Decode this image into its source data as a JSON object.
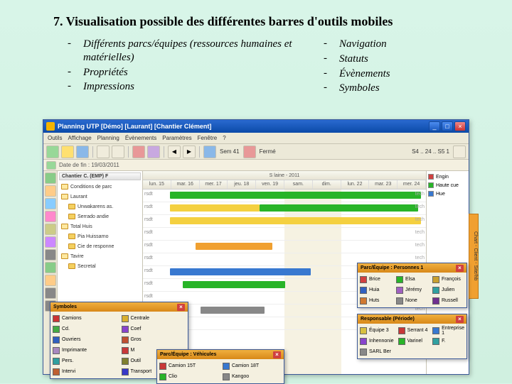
{
  "page": {
    "title": "7. Visualisation possible des différentes barres d'outils mobiles"
  },
  "bullets": {
    "left": [
      "Différents parcs/équipes (ressources humaines et matérielles)",
      "Propriétés",
      "Impressions"
    ],
    "right": [
      "Navigation",
      "Statuts",
      "Évènements",
      "Symboles"
    ]
  },
  "app": {
    "title": "Planning UTP [Démo]  [Laurant]  [Chantier Clément]",
    "winbtns": {
      "min": "_",
      "max": "□",
      "close": "×"
    },
    "menu": [
      "Outils",
      "Affichage",
      "Planning",
      "Évènements",
      "Paramètres",
      "Fenêtre",
      "?"
    ],
    "toolbar": {
      "label_sem": "Sem 41",
      "label_ferme": "Fermé",
      "label_range": "S4 .. 24 .. S5 1"
    },
    "dateline": "Date de fin : 19/03/2011",
    "tree_header": "Chantier C. (EMP) F",
    "tree": [
      {
        "lvl": 0,
        "label": "Conditions de parc"
      },
      {
        "lvl": 0,
        "label": "Laurant"
      },
      {
        "lvl": 1,
        "label": "Unwakarens as."
      },
      {
        "lvl": 1,
        "label": "Serrado andie"
      },
      {
        "lvl": 0,
        "label": "Total Huis"
      },
      {
        "lvl": 1,
        "label": "Pia Huissarno"
      },
      {
        "lvl": 1,
        "label": "Cie de responne"
      },
      {
        "lvl": 0,
        "label": "Tavire"
      },
      {
        "lvl": 1,
        "label": "Secretal"
      }
    ],
    "gantt": {
      "week": "S laine - 2011",
      "days": [
        "lun. 15",
        "mar. 16",
        "mer. 17",
        "jeu. 18",
        "ven. 19",
        "sam.",
        "dim.",
        "lun. 22",
        "mar. 23",
        "mer. 24"
      ],
      "rowlabel": "rsdt",
      "rowtag": "tech"
    },
    "rightpanel": {
      "items": [
        {
          "color": "#d04040",
          "label": "Engin"
        },
        {
          "color": "#28b428",
          "label": "Haute cue"
        },
        {
          "color": "#3878d0",
          "label": "Hue"
        }
      ]
    },
    "righttab": "Chart - Client - Site/hb"
  },
  "float": {
    "symboles": {
      "title": "Symboles",
      "items": [
        {
          "c": "#cc3333",
          "l": "Camions"
        },
        {
          "c": "#d8b030",
          "l": "Centrale"
        },
        {
          "c": "#44aa44",
          "l": "Cd."
        },
        {
          "c": "#8844cc",
          "l": "Coef"
        },
        {
          "c": "#3060c0",
          "l": "Ouvriers"
        },
        {
          "c": "#c05030",
          "l": "Gros"
        },
        {
          "c": "#a888c0",
          "l": "Imprimante"
        },
        {
          "c": "#c83838",
          "l": "M"
        },
        {
          "c": "#30a0a0",
          "l": "Pers."
        },
        {
          "c": "#808030",
          "l": "Outil"
        },
        {
          "c": "#c06030",
          "l": "Intervi"
        },
        {
          "c": "#3838c8",
          "l": "Transport"
        }
      ]
    },
    "vehicules": {
      "title": "Parc/Équipe : Véhicules",
      "items": [
        {
          "c": "#c83838",
          "l": "Camion 15T"
        },
        {
          "c": "#3878d0",
          "l": "Camion 18T"
        },
        {
          "c": "#28b428",
          "l": "Clio"
        },
        {
          "c": "#888888",
          "l": "Kangoo"
        }
      ]
    },
    "personnes": {
      "title": "Parc/Équipe : Personnes 1",
      "items": [
        {
          "c": "#d04040",
          "l": "Brice"
        },
        {
          "c": "#28b428",
          "l": "Elsa"
        },
        {
          "c": "#c8a030",
          "l": "François"
        },
        {
          "c": "#3060c0",
          "l": "Huia"
        },
        {
          "c": "#a060c0",
          "l": "Jérémy"
        },
        {
          "c": "#30a0a0",
          "l": "Julien"
        },
        {
          "c": "#d07830",
          "l": "Huts"
        },
        {
          "c": "#888",
          "l": "None"
        },
        {
          "c": "#703090",
          "l": "Russell"
        }
      ]
    },
    "responsable": {
      "title": "Responsable (Période)",
      "items": [
        {
          "c": "#d8c040",
          "l": "Équipe 3"
        },
        {
          "c": "#c83838",
          "l": "Serrant 4"
        },
        {
          "c": "#3878d0",
          "l": "Entreprise 1"
        },
        {
          "c": "#8844cc",
          "l": "Inhennonie"
        },
        {
          "c": "#28b428",
          "l": "Varinel"
        },
        {
          "c": "#30a0a0",
          "l": "F."
        },
        {
          "c": "#888",
          "l": "SARL Ber"
        }
      ]
    }
  }
}
